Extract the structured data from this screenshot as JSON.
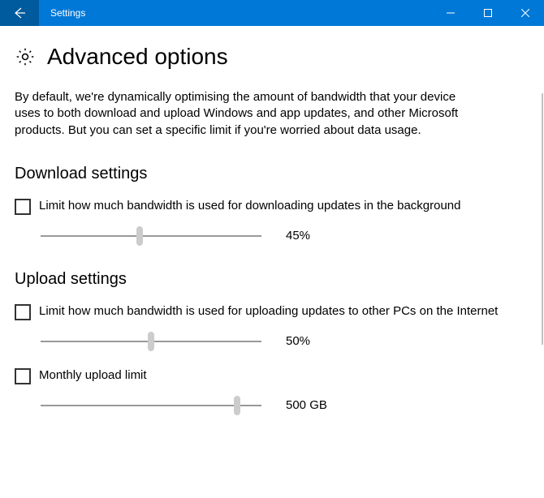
{
  "window": {
    "title": "Settings"
  },
  "page": {
    "title": "Advanced options",
    "intro": "By default, we're dynamically optimising the amount of bandwidth that your device uses to both download and upload Windows and app updates, and other Microsoft products. But you can set a specific limit if you're worried about data usage."
  },
  "download": {
    "heading": "Download settings",
    "limit_label": "Limit how much bandwidth is used for downloading updates in the background",
    "slider_percent": 45,
    "slider_value_text": "45%"
  },
  "upload": {
    "heading": "Upload settings",
    "limit_label": "Limit how much bandwidth is used for uploading updates to other PCs on the Internet",
    "slider_percent": 50,
    "slider_value_text": "50%",
    "monthly_label": "Monthly upload limit",
    "monthly_slider_percent": 89,
    "monthly_value_text": "500 GB"
  }
}
